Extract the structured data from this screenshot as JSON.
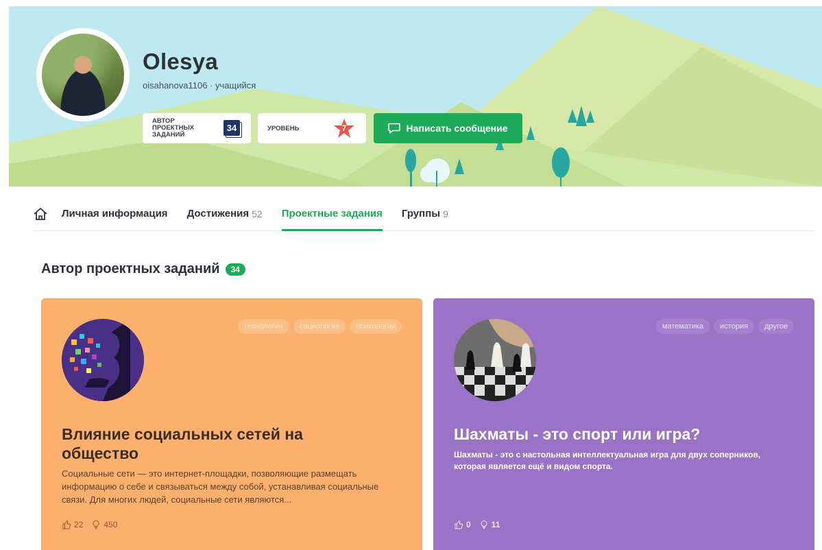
{
  "profile": {
    "name": "Olesya",
    "subtitle": "oisahanova1106 · учащийся",
    "stats": {
      "authors_label": "АВТОР ПРОЕКТНЫХ ЗАДАНИЙ",
      "authors_count": "34",
      "level_label": "УРОВЕНЬ",
      "level_value": "7"
    },
    "message_button": "Написать сообщение"
  },
  "tabs": [
    {
      "label": "Личная информация",
      "count": ""
    },
    {
      "label": "Достижения",
      "count": "52"
    },
    {
      "label": "Проектные задания",
      "count": "",
      "active": true
    },
    {
      "label": "Группы",
      "count": "9"
    }
  ],
  "section": {
    "title": "Автор проектных заданий",
    "count": "34"
  },
  "cards": [
    {
      "tags": [
        "технология",
        "социология",
        "психология"
      ],
      "title": "Влияние социальных сетей на общество",
      "description": "Социальные сети — это интернет-площадки, позволяющие размещать информацию о себе и связываться между собой, устанавливая социальные связи. Для многих людей, социальные сети являются...",
      "likes": "22",
      "ideas": "450"
    },
    {
      "tags": [
        "математика",
        "история",
        "другое"
      ],
      "title": "Шахматы - это спорт или игра?",
      "description": "Шахматы - это с настольная интеллектуальная игра для двух соперников, которая является ещё и видом спорта.",
      "likes": "0",
      "ideas": "11"
    }
  ],
  "colors": {
    "accent_green": "#1eaa5b",
    "card_orange": "#fdb06d",
    "card_purple": "#9a72c6",
    "badge_navy": "#1e3566",
    "level_star": "#e8574f"
  },
  "icons": [
    "home-icon",
    "message-icon",
    "like-icon",
    "idea-icon",
    "star-icon"
  ]
}
